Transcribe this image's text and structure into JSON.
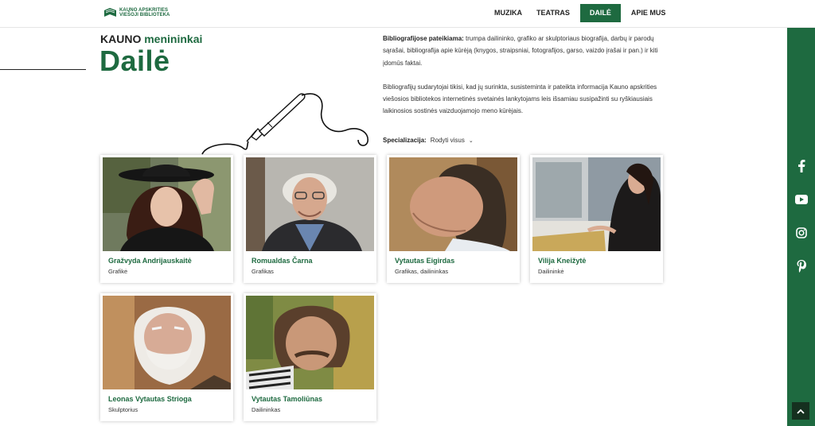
{
  "header": {
    "logo_line1": "KAUNO APSKRITIES",
    "logo_line2": "VIEŠOJI BIBLIOTEKA",
    "nav": [
      {
        "label": "MUZIKA"
      },
      {
        "label": "TEATRAS"
      },
      {
        "label": "DAILĖ",
        "active": true
      },
      {
        "label": "APIE MUS"
      }
    ]
  },
  "hero": {
    "kicker_prefix": "KAUNO",
    "kicker_suffix": "menininkai",
    "title": "Dailė"
  },
  "intro": {
    "p1_bold": "Bibliografijose pateikiama:",
    "p1_text": " trumpa dailininko, grafiko ar skulptoriaus biografija, darbų ir parodų sąrašai, bibliografija apie kūrėją (knygos, straipsniai, fotografijos, garso, vaizdo įrašai ir pan.) ir kiti įdomūs faktai.",
    "p2": "Bibliografijų sudarytojai tikisi, kad jų surinkta, susisteminta ir pateikta informacija Kauno apskrities viešosios bibliotekos internetinės svetainės lankytojams leis išsamiau susipažinti su ryškiausiais laikinosios sostinės vaizduojamojo meno kūrėjais."
  },
  "filter": {
    "label": "Specializacija:",
    "selected": "Rodyti visus"
  },
  "artists": [
    {
      "name": "Gražvyda Andrijauskaitė",
      "role": "Grafikė"
    },
    {
      "name": "Romualdas Čarna",
      "role": "Grafikas"
    },
    {
      "name": "Vytautas Eigirdas",
      "role": "Grafikas, dailininkas"
    },
    {
      "name": "Vilija Kneižytė",
      "role": "Dailininkė"
    },
    {
      "name": "Leonas Vytautas Strioga",
      "role": "Skulptorius"
    },
    {
      "name": "Vytautas Tamoliūnas",
      "role": "Dailininkas"
    }
  ],
  "social": [
    "facebook-icon",
    "youtube-icon",
    "instagram-icon",
    "pinterest-icon"
  ],
  "colors": {
    "brand_green": "#1e6a40",
    "dark": "#15301f"
  }
}
